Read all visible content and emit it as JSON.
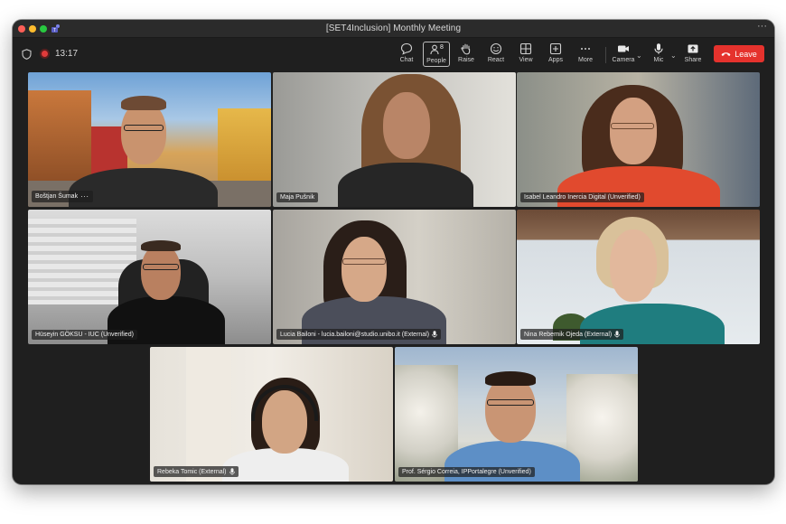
{
  "window": {
    "title": "[SET4Inclusion] Monthly Meeting"
  },
  "status": {
    "timer": "13:17"
  },
  "toolbar": {
    "chat": "Chat",
    "people": "People",
    "people_count": "8",
    "raise": "Raise",
    "react": "React",
    "view": "View",
    "apps": "Apps",
    "more": "More",
    "camera": "Camera",
    "mic": "Mic",
    "share": "Share",
    "leave": "Leave"
  },
  "participants": [
    {
      "name": "Boštjan Šumak"
    },
    {
      "name": "Maja Pušnik"
    },
    {
      "name": "Isabel Leandro Inercia Digital (Unverified)"
    },
    {
      "name": "Hüseyin GÖKSU - IUC (Unverified)"
    },
    {
      "name": "Lucia Bailoni - lucia.bailoni@studio.unibo.it (External)"
    },
    {
      "name": "Nina Rebernik Ojeda (External)"
    },
    {
      "name": "Rebeka Tomic (External)"
    },
    {
      "name": "Prof. Sérgio Correia, IPPortalegre (Unverified)"
    }
  ],
  "colors": {
    "leave": "#e5322d",
    "window_bg": "#1f1f1f",
    "record": "#e23b3b"
  }
}
